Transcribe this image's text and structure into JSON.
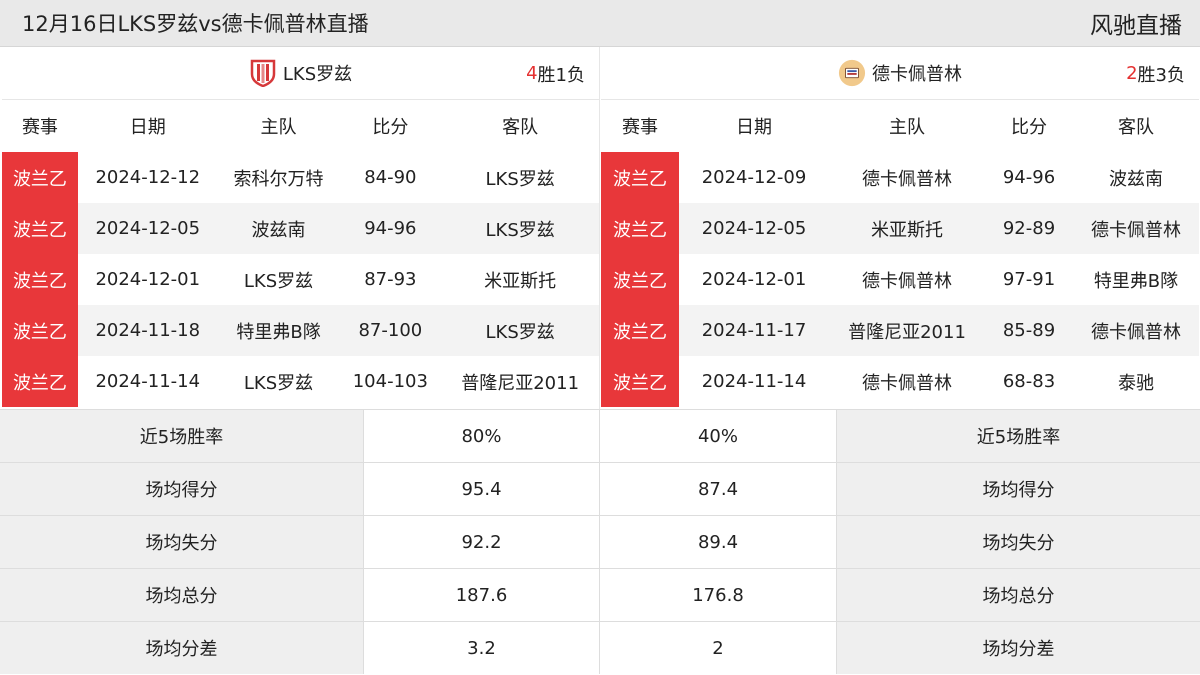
{
  "header": {
    "title": "12月16日LKS罗兹vs德卡佩普林直播",
    "brand": "风驰直播"
  },
  "columns": [
    "赛事",
    "日期",
    "主队",
    "比分",
    "客队"
  ],
  "colors": {
    "league_bg": "#e8373a",
    "win_count": "#e53030"
  },
  "left": {
    "team": "LKS罗兹",
    "logo_icon": "lks-shield-logo",
    "record_win": "4",
    "record_win_suffix": "胜",
    "record_loss": "1负",
    "rows": [
      {
        "league": "波兰乙",
        "date": "2024-12-12",
        "home": "索科尔万特",
        "score": "84-90",
        "away": "LKS罗兹"
      },
      {
        "league": "波兰乙",
        "date": "2024-12-05",
        "home": "波兹南",
        "score": "94-96",
        "away": "LKS罗兹"
      },
      {
        "league": "波兰乙",
        "date": "2024-12-01",
        "home": "LKS罗兹",
        "score": "87-93",
        "away": "米亚斯托"
      },
      {
        "league": "波兰乙",
        "date": "2024-11-18",
        "home": "特里弗B隊",
        "score": "87-100",
        "away": "LKS罗兹"
      },
      {
        "league": "波兰乙",
        "date": "2024-11-14",
        "home": "LKS罗兹",
        "score": "104-103",
        "away": "普隆尼亚2011"
      }
    ]
  },
  "right": {
    "team": "德卡佩普林",
    "logo_icon": "dekaplan-round-logo",
    "record_win": "2",
    "record_win_suffix": "胜",
    "record_loss": "3负",
    "rows": [
      {
        "league": "波兰乙",
        "date": "2024-12-09",
        "home": "德卡佩普林",
        "score": "94-96",
        "away": "波兹南"
      },
      {
        "league": "波兰乙",
        "date": "2024-12-05",
        "home": "米亚斯托",
        "score": "92-89",
        "away": "德卡佩普林"
      },
      {
        "league": "波兰乙",
        "date": "2024-12-01",
        "home": "德卡佩普林",
        "score": "97-91",
        "away": "特里弗B隊"
      },
      {
        "league": "波兰乙",
        "date": "2024-11-17",
        "home": "普隆尼亚2011",
        "score": "85-89",
        "away": "德卡佩普林"
      },
      {
        "league": "波兰乙",
        "date": "2024-11-14",
        "home": "德卡佩普林",
        "score": "68-83",
        "away": "泰驰"
      }
    ]
  },
  "stats": [
    {
      "label": "近5场胜率",
      "left": "80%",
      "right": "40%"
    },
    {
      "label": "场均得分",
      "left": "95.4",
      "right": "87.4"
    },
    {
      "label": "场均失分",
      "left": "92.2",
      "right": "89.4"
    },
    {
      "label": "场均总分",
      "left": "187.6",
      "right": "176.8"
    },
    {
      "label": "场均分差",
      "left": "3.2",
      "right": "2"
    }
  ]
}
